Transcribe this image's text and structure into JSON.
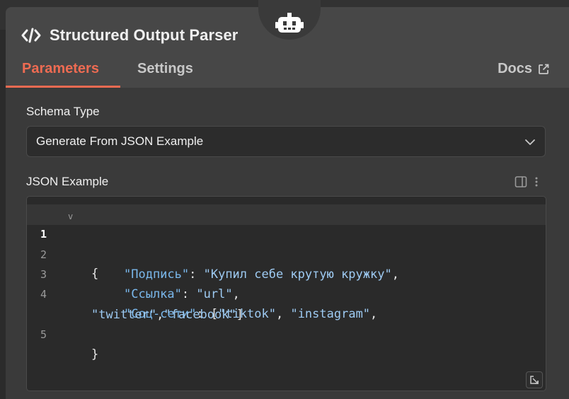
{
  "node": {
    "title": "Structured Output Parser"
  },
  "tabs": [
    {
      "label": "Parameters",
      "active": true
    },
    {
      "label": "Settings",
      "active": false
    }
  ],
  "docs_label": "Docs",
  "schema_type": {
    "label": "Schema Type",
    "value": "Generate From JSON Example"
  },
  "json_example": {
    "label": "JSON Example",
    "lines": [
      {
        "number": "1",
        "text": "{"
      },
      {
        "number": "2",
        "key": "\"Подпись\"",
        "sep": ": ",
        "value": "\"Купил себе крутую кружку\"",
        "tail": ","
      },
      {
        "number": "3",
        "key": "\"Ссылка\"",
        "sep": ": ",
        "value": "\"url\"",
        "tail": ","
      },
      {
        "number": "4",
        "key": "\"Соц-сети\"",
        "sep": ": [",
        "value": "\"tiktok\"",
        "tail": ", ",
        "value2": "\"instagram\"",
        "tail2": ","
      },
      {
        "number": "",
        "value": "\"twitter\"",
        "tail": ",",
        "value2": "\"facebook\"",
        "tail2": "]"
      },
      {
        "number": "5",
        "text": "}"
      }
    ]
  },
  "colors": {
    "accent": "#ee6b52",
    "json_key": "#7ab8ec",
    "json_string": "#9ecbf3"
  },
  "icons": [
    "robot-icon",
    "code-icon",
    "external-link-icon",
    "chevron-down-icon",
    "panel-icon",
    "more-vertical-icon",
    "fold-icon",
    "expand-icon"
  ]
}
